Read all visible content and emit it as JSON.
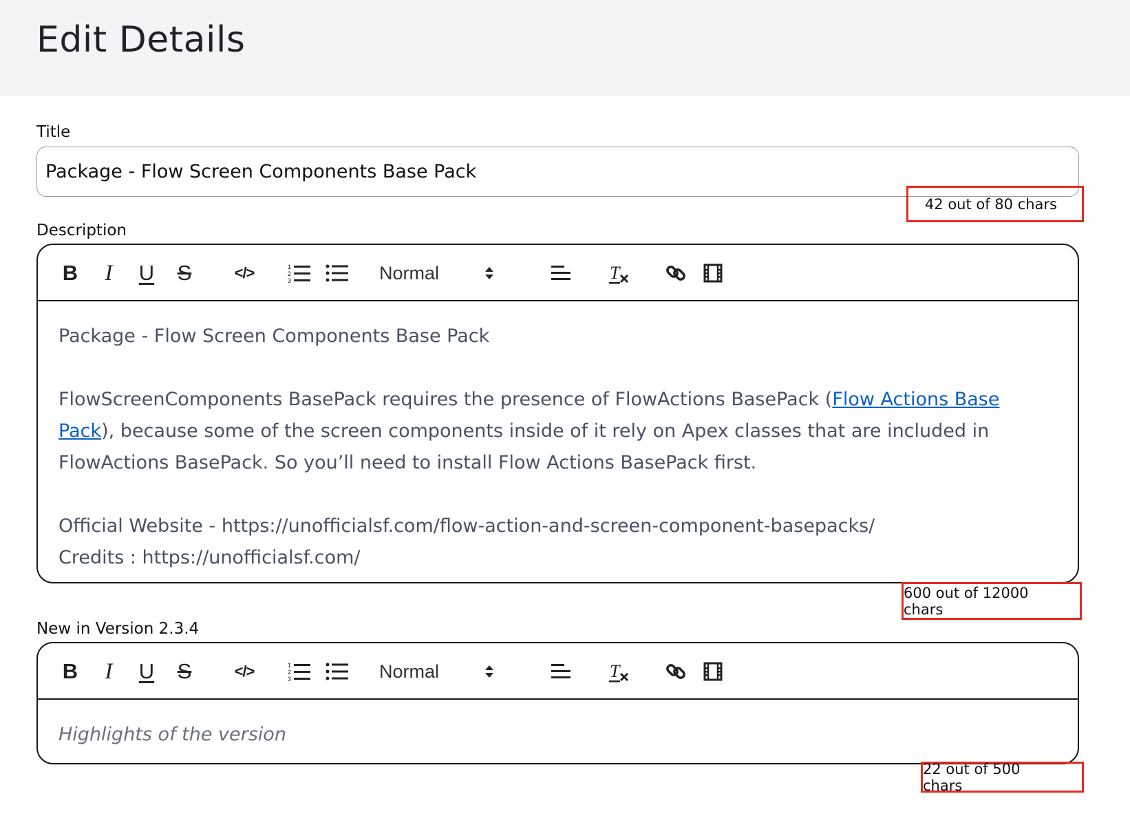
{
  "page": {
    "title": "Edit Details"
  },
  "title_field": {
    "label": "Title",
    "value": "Package - Flow Screen Components Base Pack",
    "counter": "42 out of 80 chars"
  },
  "description_field": {
    "label": "Description",
    "counter": "600 out of 12000 chars",
    "paragraph1": "Package - Flow Screen Components Base Pack",
    "paragraph2_before": "FlowScreenComponents BasePack requires the presence of FlowActions BasePack (",
    "paragraph2_link": "Flow Actions Base Pack",
    "paragraph2_after": "), because some of the screen components inside of it rely on Apex classes that are included in FlowActions BasePack. So you’ll need to install Flow Actions BasePack first.",
    "website_line": "Official Website - https://unofficialsf.com/flow-action-and-screen-component-basepacks/",
    "credits_line": "Credits : https://unofficialsf.com/"
  },
  "version_field": {
    "label": "New in Version 2.3.4",
    "placeholder": "Highlights of the version",
    "counter": "22 out of 500 chars"
  },
  "toolbar": {
    "bold": "B",
    "italic": "I",
    "underline": "U",
    "strike": "S",
    "code": "</>",
    "heading_select": "Normal"
  },
  "icons": [
    "bold-icon",
    "italic-icon",
    "underline-icon",
    "strike-icon",
    "code-icon",
    "ordered-list-icon",
    "bullet-list-icon",
    "select-arrows-icon",
    "align-left-icon",
    "clear-format-icon",
    "link-icon",
    "video-icon"
  ],
  "colors": {
    "counter_border": "#e32b24",
    "link": "#0b5fc7",
    "header_bg": "#f3f4f6",
    "body_text": "#4a5261"
  }
}
